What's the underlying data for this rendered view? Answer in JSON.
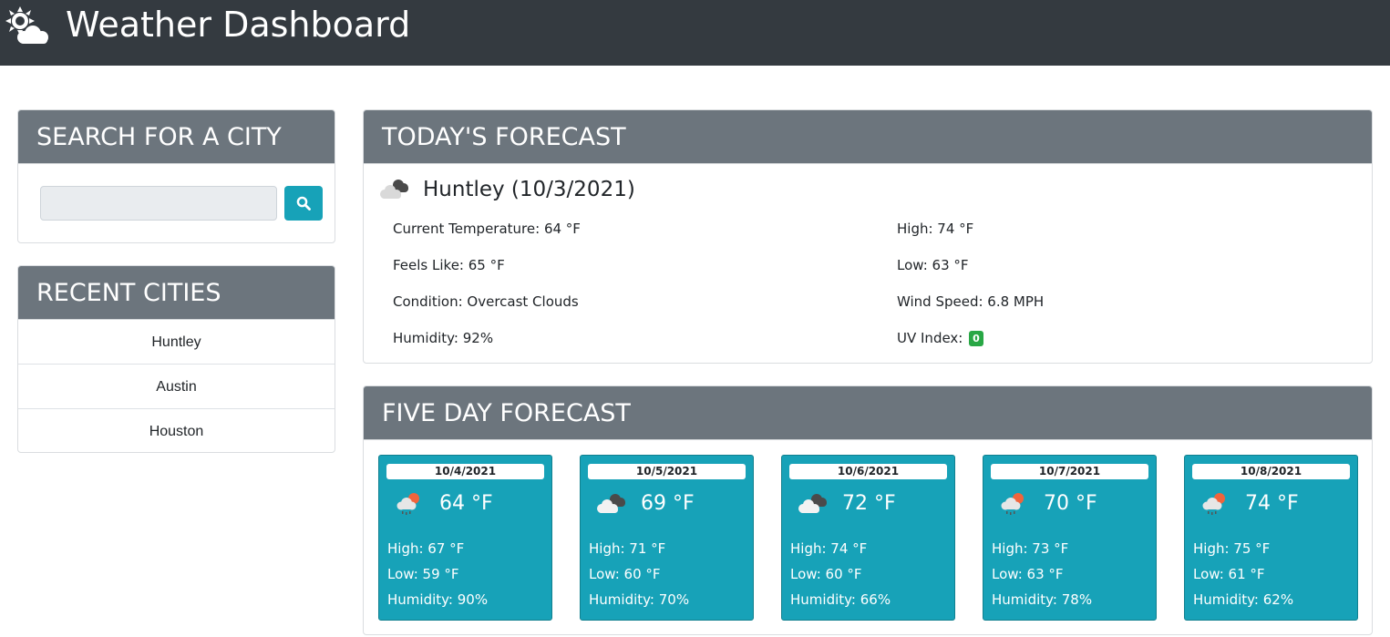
{
  "app": {
    "title": "Weather Dashboard",
    "logo_icon": "sun-cloud-icon"
  },
  "search": {
    "heading": "SEARCH FOR A CITY",
    "input_value": "",
    "button_icon": "search-icon"
  },
  "recent": {
    "heading": "RECENT CITIES",
    "cities": [
      "Huntley",
      "Austin",
      "Houston"
    ]
  },
  "today": {
    "heading": "TODAY'S FORECAST",
    "icon": "overcast-clouds-icon",
    "title": "Huntley (10/3/2021)",
    "current_temperature": "Current Temperature: 64 °F",
    "feels_like": "Feels Like: 65 °F",
    "condition": "Condition: Overcast Clouds",
    "humidity": "Humidity: 92%",
    "high": "High: 74 °F",
    "low": "Low: 63 °F",
    "wind_speed": "Wind Speed: 6.8 MPH",
    "uv_label": "UV Index:",
    "uv_value": "0",
    "uv_color": "#28a745"
  },
  "five_day": {
    "heading": "FIVE DAY FORECAST",
    "days": [
      {
        "date": "10/4/2021",
        "icon": "rain-sun-icon",
        "temp": "64 °F",
        "high": "High: 67 °F",
        "low": "Low: 59 °F",
        "humidity": "Humidity: 90%"
      },
      {
        "date": "10/5/2021",
        "icon": "broken-clouds-icon",
        "temp": "69 °F",
        "high": "High: 71 °F",
        "low": "Low: 60 °F",
        "humidity": "Humidity: 70%"
      },
      {
        "date": "10/6/2021",
        "icon": "broken-clouds-icon",
        "temp": "72 °F",
        "high": "High: 74 °F",
        "low": "Low: 60 °F",
        "humidity": "Humidity: 66%"
      },
      {
        "date": "10/7/2021",
        "icon": "rain-sun-icon",
        "temp": "70 °F",
        "high": "High: 73 °F",
        "low": "Low: 63 °F",
        "humidity": "Humidity: 78%"
      },
      {
        "date": "10/8/2021",
        "icon": "rain-sun-icon",
        "temp": "74 °F",
        "high": "High: 75 °F",
        "low": "Low: 61 °F",
        "humidity": "Humidity: 62%"
      }
    ]
  },
  "colors": {
    "navbar": "#343a40",
    "card_header": "#6c757d",
    "accent": "#17a2b8",
    "uv_good": "#28a745"
  }
}
